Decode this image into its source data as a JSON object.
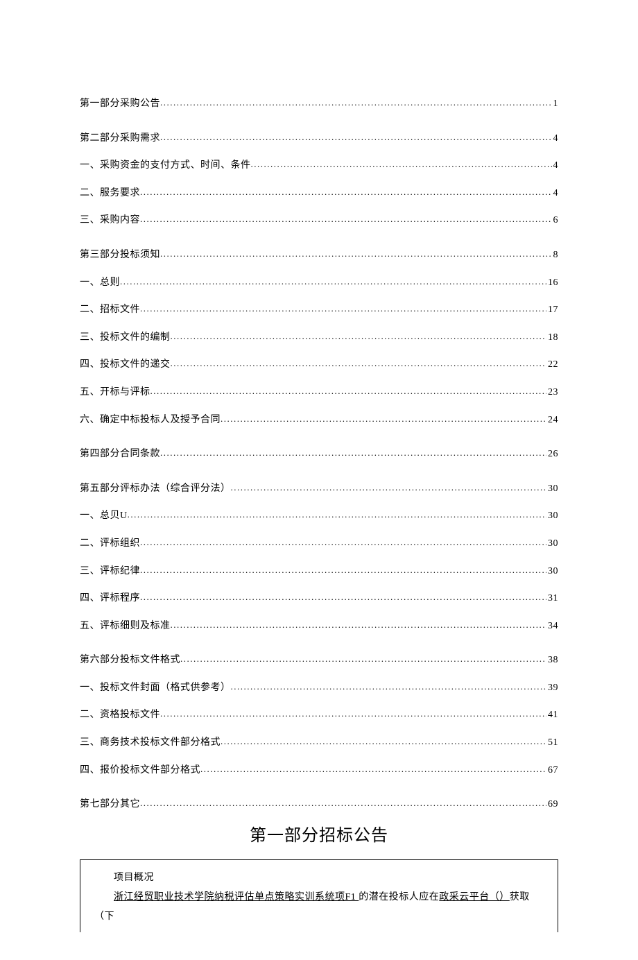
{
  "toc": [
    {
      "label": "第一部分采购公告",
      "page": "1",
      "cls": "section first"
    },
    {
      "label": "第二部分采购需求",
      "page": "4",
      "cls": "section"
    },
    {
      "label": "一、采购资金的支付方式、时间、条件",
      "page": "4",
      "cls": "sub"
    },
    {
      "label": "二、服务要求",
      "page": "4",
      "cls": "sub"
    },
    {
      "label": "三、采购内容",
      "page": "6",
      "cls": "sub"
    },
    {
      "label": "第三部分投标须知",
      "page": "8",
      "cls": "section"
    },
    {
      "label": "一、总则",
      "page": "16",
      "cls": "sub"
    },
    {
      "label": "二、招标文件",
      "page": "17",
      "cls": "sub"
    },
    {
      "label": "三、投标文件的编制",
      "page": "18",
      "cls": "sub"
    },
    {
      "label": "四、投标文件的递交",
      "page": "22",
      "cls": "sub"
    },
    {
      "label": "五、开标与评标",
      "page": "23",
      "cls": "sub"
    },
    {
      "label": "六、确定中标投标人及授予合同",
      "page": "24",
      "cls": "sub"
    },
    {
      "label": "第四部分合同条款",
      "page": "26",
      "cls": "section"
    },
    {
      "label": "第五部分评标办法（综合评分法）",
      "page": "30",
      "cls": "section"
    },
    {
      "label": "一、总贝U",
      "page": "30",
      "cls": "sub"
    },
    {
      "label": "二、评标组织",
      "page": "30",
      "cls": "sub"
    },
    {
      "label": "三、评标纪律",
      "page": "30",
      "cls": "sub"
    },
    {
      "label": "四、评标程序",
      "page": "31",
      "cls": "sub"
    },
    {
      "label": "五、评标细则及标准",
      "page": "34",
      "cls": "sub"
    },
    {
      "label": "第六部分投标文件格式",
      "page": "38",
      "cls": "section"
    },
    {
      "label": "一、投标文件封面（格式供参考）",
      "page": "39",
      "cls": "sub"
    },
    {
      "label": "二、资格投标文件",
      "page": "41",
      "cls": "sub"
    },
    {
      "label": "三、商务技术投标文件部分格式",
      "page": "51",
      "cls": "sub"
    },
    {
      "label": "四、报价投标文件部分格式",
      "page": "67",
      "cls": "sub"
    },
    {
      "label": "第七部分其它",
      "page": "69",
      "cls": "section"
    }
  ],
  "heading": "第一部分招标公告",
  "box": {
    "line1": "项目概况",
    "line2_u1": "浙江经贸职业技术学院纳税评估单点策略实训系统项F1 ",
    "line2_mid": "的潜在投标人应在",
    "line2_u2": "政采云平台（）",
    "line2_tail": "获取（下"
  }
}
